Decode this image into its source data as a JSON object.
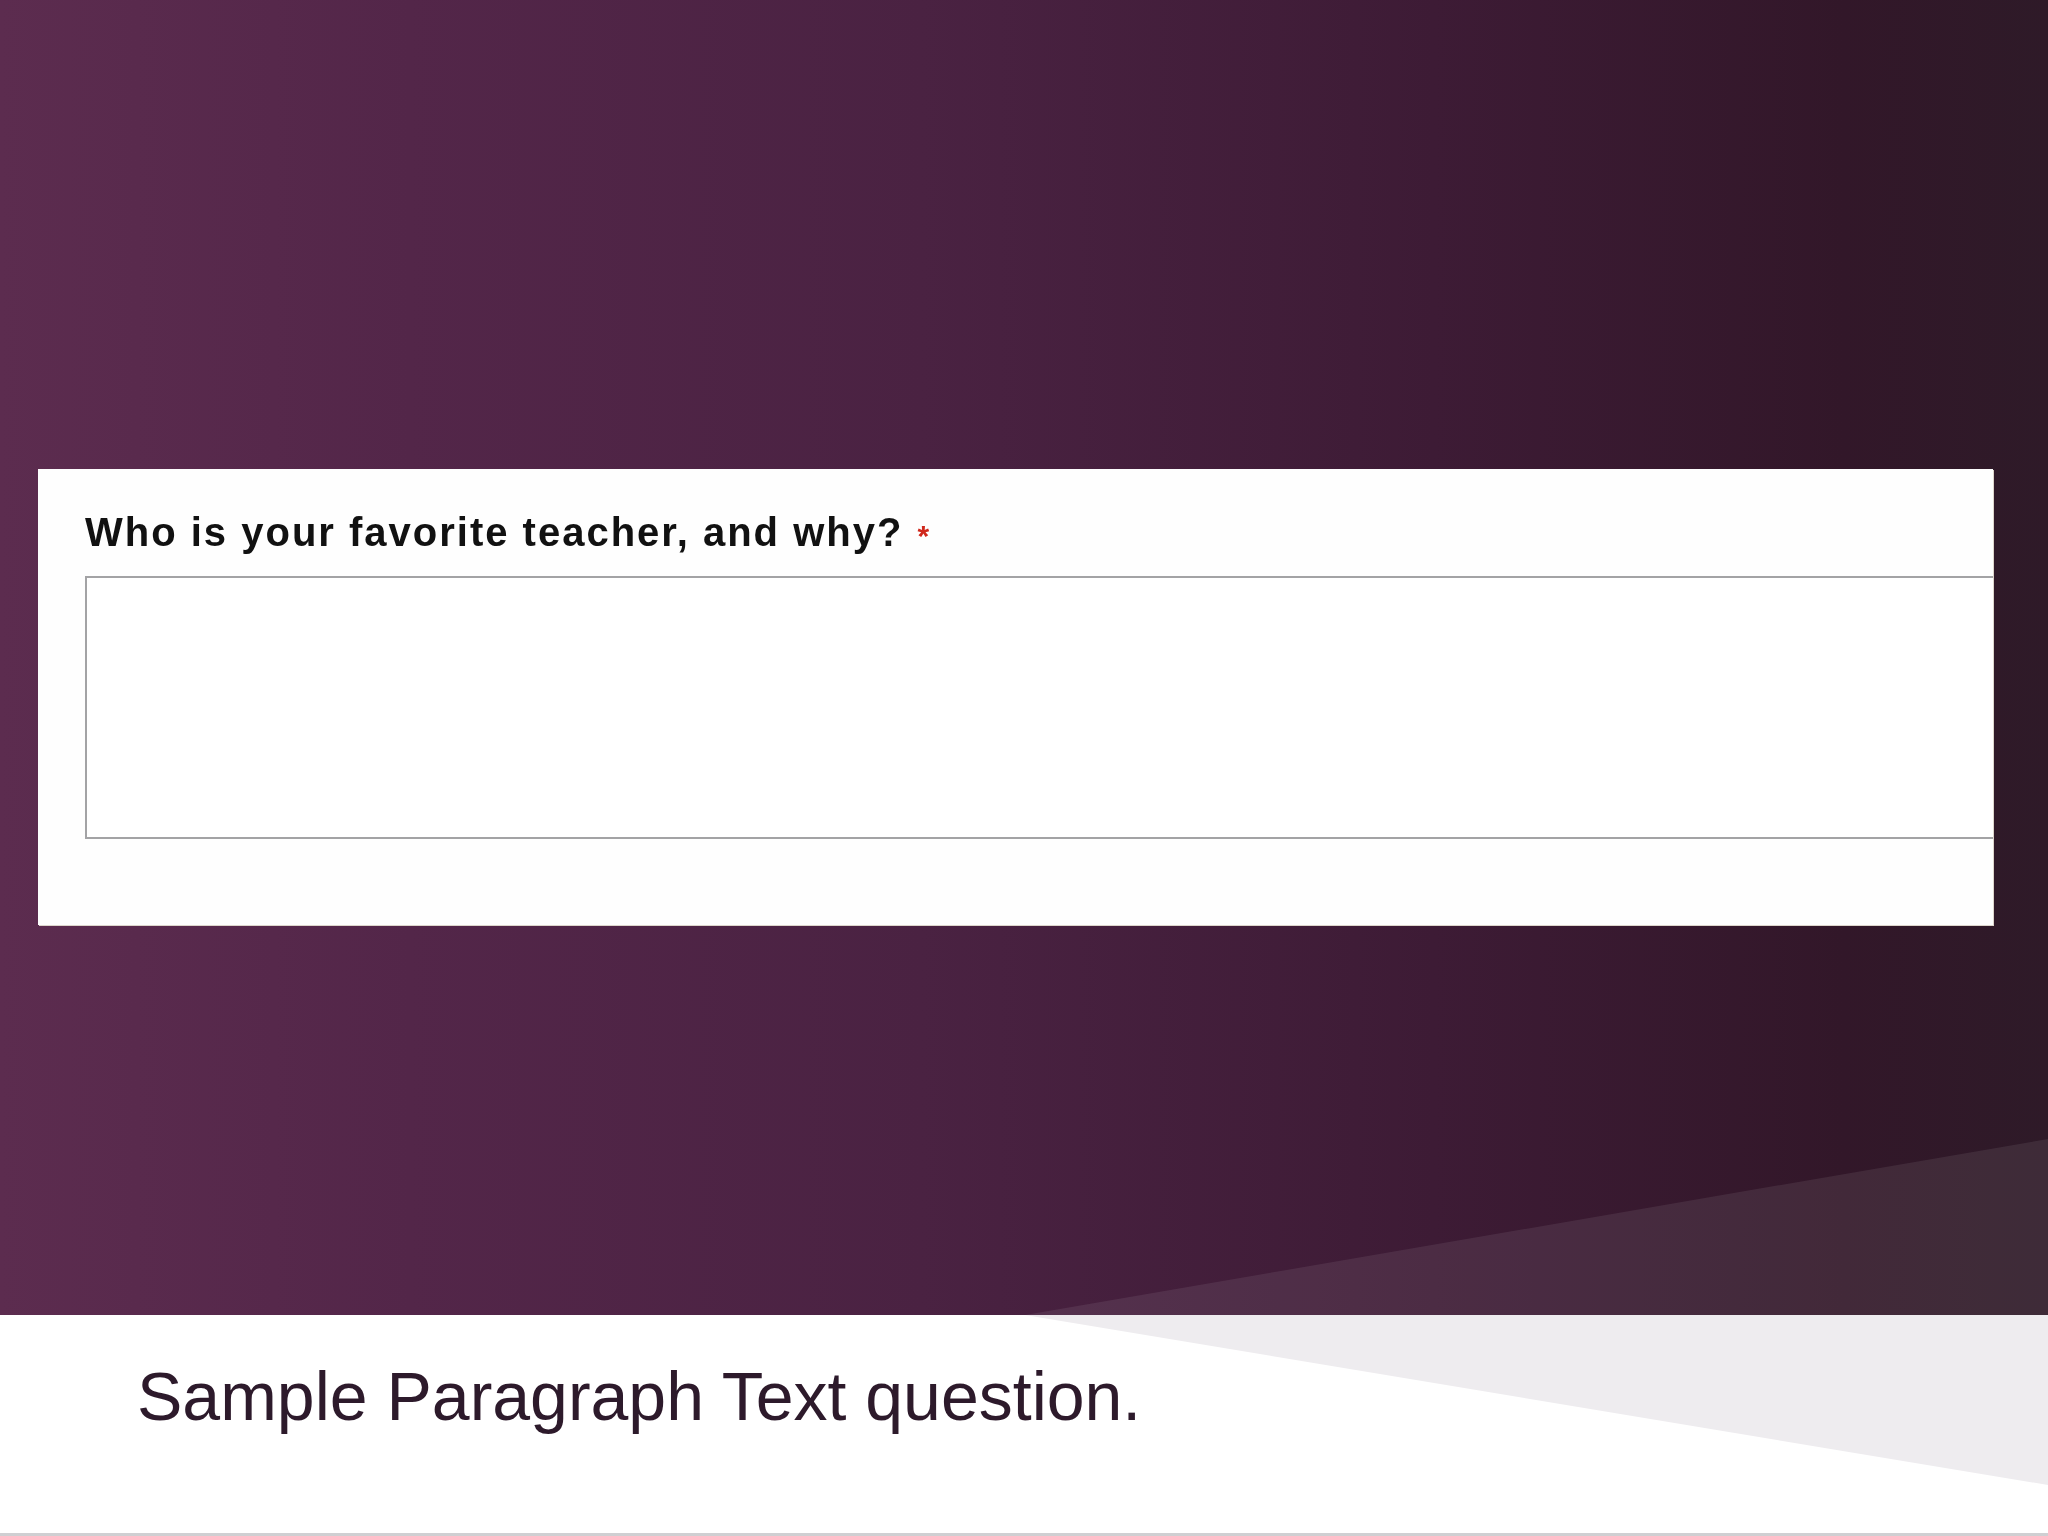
{
  "form_card": {
    "question": "Who is your favorite teacher, and why?",
    "required_marker": "*"
  },
  "caption": "Sample Paragraph Text question."
}
